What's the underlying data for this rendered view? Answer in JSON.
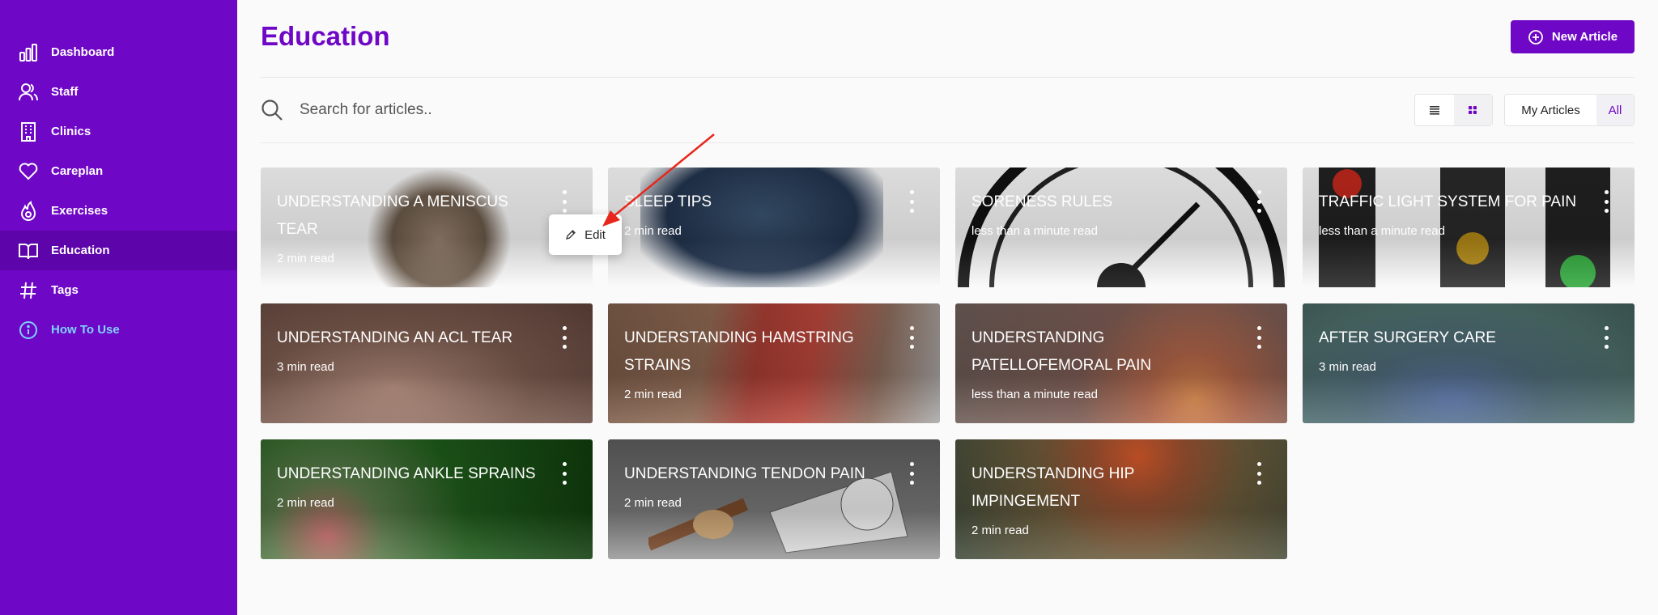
{
  "sidebar": {
    "items": [
      {
        "label": "Dashboard",
        "icon": "chart-bar-icon"
      },
      {
        "label": "Staff",
        "icon": "users-icon"
      },
      {
        "label": "Clinics",
        "icon": "building-icon"
      },
      {
        "label": "Careplan",
        "icon": "heart-icon"
      },
      {
        "label": "Exercises",
        "icon": "flame-icon"
      },
      {
        "label": "Education",
        "icon": "book-open-icon",
        "active": true
      },
      {
        "label": "Tags",
        "icon": "hash-icon"
      },
      {
        "label": "How To Use",
        "icon": "info-circle-icon"
      }
    ]
  },
  "header": {
    "title": "Education",
    "new_button_label": "New Article"
  },
  "search": {
    "placeholder": "Search for articles.."
  },
  "filters": {
    "my_articles_label": "My Articles",
    "all_label": "All",
    "selected": "All",
    "view_selected": "grid"
  },
  "cards": [
    {
      "title": "UNDERSTANDING A MENISCUS TEAR",
      "read": "2 min read",
      "bg": "#2f5a4a"
    },
    {
      "title": "SLEEP TIPS",
      "read": "2 min read",
      "bg": "#1e2e44"
    },
    {
      "title": "SORENESS RULES",
      "read": "less than a minute read",
      "bg": "#575757"
    },
    {
      "title": "TRAFFIC LIGHT SYSTEM FOR PAIN",
      "read": "less than a minute read",
      "bg": "#3a4b68"
    },
    {
      "title": "UNDERSTANDING AN ACL TEAR",
      "read": "3 min read",
      "bg": "#6c5047"
    },
    {
      "title": "UNDERSTANDING HAMSTRING STRAINS",
      "read": "2 min read",
      "bg": "#7a5a4a"
    },
    {
      "title": "UNDERSTANDING PATELLOFEMORAL PAIN",
      "read": "less than a minute read",
      "bg": "#74574f"
    },
    {
      "title": "AFTER SURGERY CARE",
      "read": "3 min read",
      "bg": "#4a6a67"
    },
    {
      "title": "UNDERSTANDING ANKLE SPRAINS",
      "read": "2 min read",
      "bg": "#1f4a1e"
    },
    {
      "title": "UNDERSTANDING TENDON PAIN",
      "read": "2 min read",
      "bg": "#676767"
    },
    {
      "title": "UNDERSTANDING HIP IMPINGEMENT",
      "read": "2 min read",
      "bg": "#3c3a33"
    }
  ],
  "context_menu": {
    "edit_label": "Edit"
  },
  "colors": {
    "brand": "#6f07c6",
    "sidebar_active": "#5d04aa",
    "help_link": "#7ed3ff",
    "annotation_arrow": "#e8271c"
  }
}
